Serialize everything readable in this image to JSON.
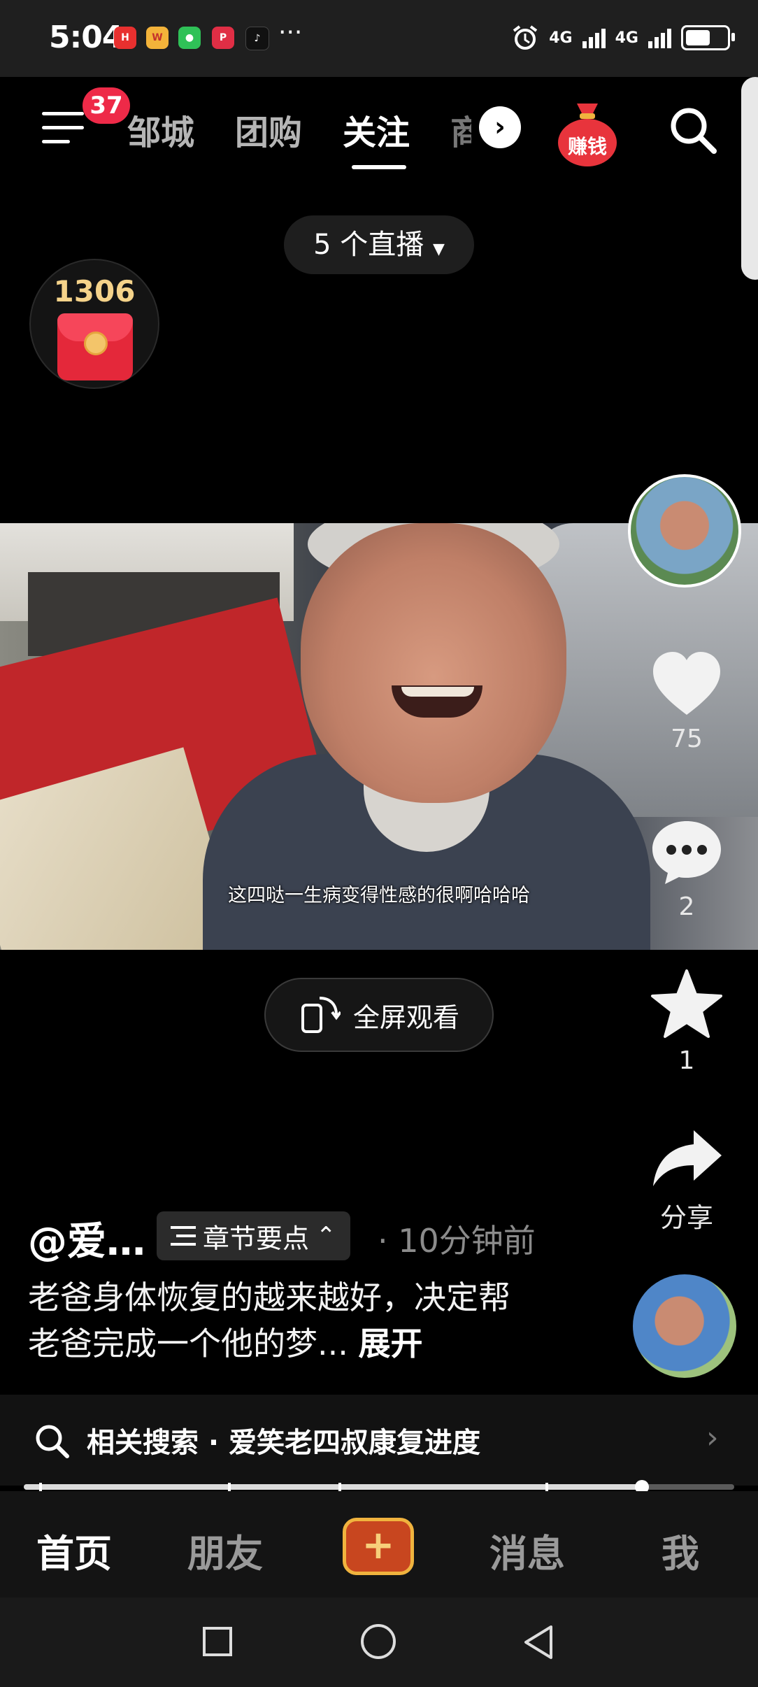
{
  "status_bar": {
    "time": "5:04",
    "apps": [
      "huawei-app",
      "weibo-app",
      "wechat-app",
      "pinduoduo-app",
      "douyin-app"
    ],
    "more": "···",
    "network_1": "4G",
    "network_2": "4G"
  },
  "top_nav": {
    "menu_badge": "37",
    "tabs": [
      "邹城",
      "团购",
      "关注",
      "商"
    ],
    "active_tab": "关注",
    "earn_label": "赚钱"
  },
  "live_pill": {
    "label": "5 个直播"
  },
  "red_packet": {
    "count": "1306"
  },
  "video": {
    "subtitle": "这四哒一生病变得性感的很啊哈哈哈",
    "fullscreen_label": "全屏观看"
  },
  "right_rail": {
    "likes": "75",
    "comments": "2",
    "favorites": "1",
    "share_label": "分享"
  },
  "post": {
    "author": "@爱…",
    "chapter_label": "章节要点",
    "time_ago": "· 10分钟前",
    "caption": "老爸身体恢复的越来越好，决定帮老爸完成一个他的梦...",
    "expand_label": "展开"
  },
  "related_search": {
    "label": "相关搜索 · 爱笑老四叔康复进度"
  },
  "playback": {
    "progress": 0.87
  },
  "bottom_nav": {
    "items": [
      "首页",
      "朋友",
      "+",
      "消息",
      "我"
    ],
    "active": "首页"
  },
  "colors": {
    "badge": "#ee2a48",
    "accent_gold": "#f0b33e",
    "earn_red": "#e8343c"
  }
}
